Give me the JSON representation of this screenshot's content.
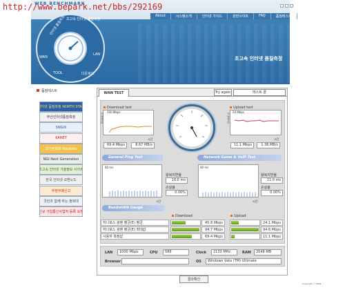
{
  "watermark": "http://www.bepark.net/bbs/292169",
  "header": {
    "logo_text": "WEB BENCHMARK",
    "nav": [
      "About",
      "시스템소개",
      "인터넷 가이드",
      "관련사이트",
      "FAQ",
      "품질테스트"
    ],
    "title": "초고속 인터넷 품질측정",
    "emblem_labels": [
      "인터넷 품질측정",
      "초고속 인터넷 품질측정",
      "WAN",
      "LAN",
      "TOOL",
      "다운로드"
    ]
  },
  "sidebar": {
    "title": "품질테스트",
    "banners": [
      {
        "text": "인터넷 품질측정 NORTH STAR",
        "bg": "#2b5fa8",
        "color": "#ffe26a"
      },
      {
        "text": "부산인터넷품질측정",
        "bg": "#f2f2f2",
        "color": "#333333"
      },
      {
        "text": "SNGIX",
        "bg": "#e8f0fa",
        "color": "#2a4fa0"
      },
      {
        "text": "KANET",
        "bg": "#fff0f0",
        "color": "#c02020"
      },
      {
        "text": "국가정보화 Potalsite",
        "bg": "#f4c24a",
        "color": "#ffffff"
      },
      {
        "text": "NGI Next Generation",
        "bg": "#eaeaea",
        "color": "#333333"
      },
      {
        "text": "초고속 인터넷 기술정보 사이트",
        "bg": "#e2f0d6",
        "color": "#3a6a2a"
      },
      {
        "text": "한국 인터넷 교환노드",
        "bg": "#f0f0f0",
        "color": "#444444"
      },
      {
        "text": "부정부패신고",
        "bg": "#fde8d0",
        "color": "#c03a10"
      },
      {
        "text": "국민과 함께 하는 청와대",
        "bg": "#eef2f6",
        "color": "#334455"
      },
      {
        "text": "신규 가입통신사업자 등록 요청",
        "bg": "#fbe6e6",
        "color": "#b02020"
      }
    ]
  },
  "toolbar": {
    "tab_label": "WAN TEST",
    "try_again_label": "Try again",
    "test_select_value": "테스트 끝"
  },
  "download": {
    "title": "Download test",
    "scale_label": "200 Mbps",
    "axis_label": "시간",
    "vlabel": "전송속도",
    "value_mbps": "69.4",
    "unit_mbps": "Mbps",
    "value_mbs": "8.67",
    "unit_mbs": "MB/s"
  },
  "upload": {
    "title": "Upload test",
    "scale_label": "20 Mbps",
    "axis_label": "시간",
    "vlabel": "전송속도",
    "value_mbps": "11.1",
    "unit_mbps": "Mbps",
    "value_mbs": "1.38",
    "unit_mbs": "MB/s"
  },
  "ping": {
    "header": "General Ping Test",
    "scale_label": "60 ms",
    "axis_label": "시간",
    "vlabel": "지연시간",
    "rtt_label": "왕복지연율",
    "rtt_value": "16.5 ms",
    "loss_label": "손실율",
    "loss_value": "0.00%"
  },
  "game": {
    "header": "Network Game & VoIP Test",
    "scale_label": "60 ms",
    "axis_label": "시간",
    "vlabel": "지연시간",
    "rtt_label": "왕복지연율",
    "rtt_value": "11.0 ms",
    "loss_label": "손실율",
    "loss_value": "0.00%"
  },
  "bandwidth": {
    "header": "Bandwidth Gauge",
    "download_label": "Download",
    "upload_label": "Upload",
    "rows": [
      {
        "label": "하나포스 광랜 평균(E) 평균",
        "down_value": "45.8 Mbps",
        "up_value": "24.1 Mbps",
        "down_ratio": 0.47,
        "up_ratio": 0.25
      },
      {
        "label": "하나포스 광랜 평균(E) 최대값",
        "down_value": "94.7 Mbps",
        "up_value": "94.6 Mbps",
        "down_ratio": 0.95,
        "up_ratio": 0.95
      },
      {
        "label": "사용자 측정값",
        "down_value": "69.4 Mbps",
        "up_value": "11.1 Mbps",
        "down_ratio": 0.7,
        "up_ratio": 0.12
      }
    ]
  },
  "sysinfo": {
    "lan_label": "LAN",
    "lan_value": "1000 Mbps",
    "cpu_label": "CPU",
    "cpu_value": "586",
    "clock_label": "Clock",
    "clock_value": "2133 MHz",
    "ram_label": "RAM",
    "ram_value": "2048 MB",
    "browser_label": "Browser",
    "browser_value": "",
    "os_label": "OS",
    "os_value": "Windows Vata (TM) Ultimate"
  },
  "confirm_label": "결과확인",
  "copyright": "Copyright ⓒ 2008 ...",
  "colors": {
    "header_blue": "#2b6aa3",
    "bar_green": "#6fb820",
    "download_line": "#e08020",
    "upload_line": "#c03a70"
  }
}
